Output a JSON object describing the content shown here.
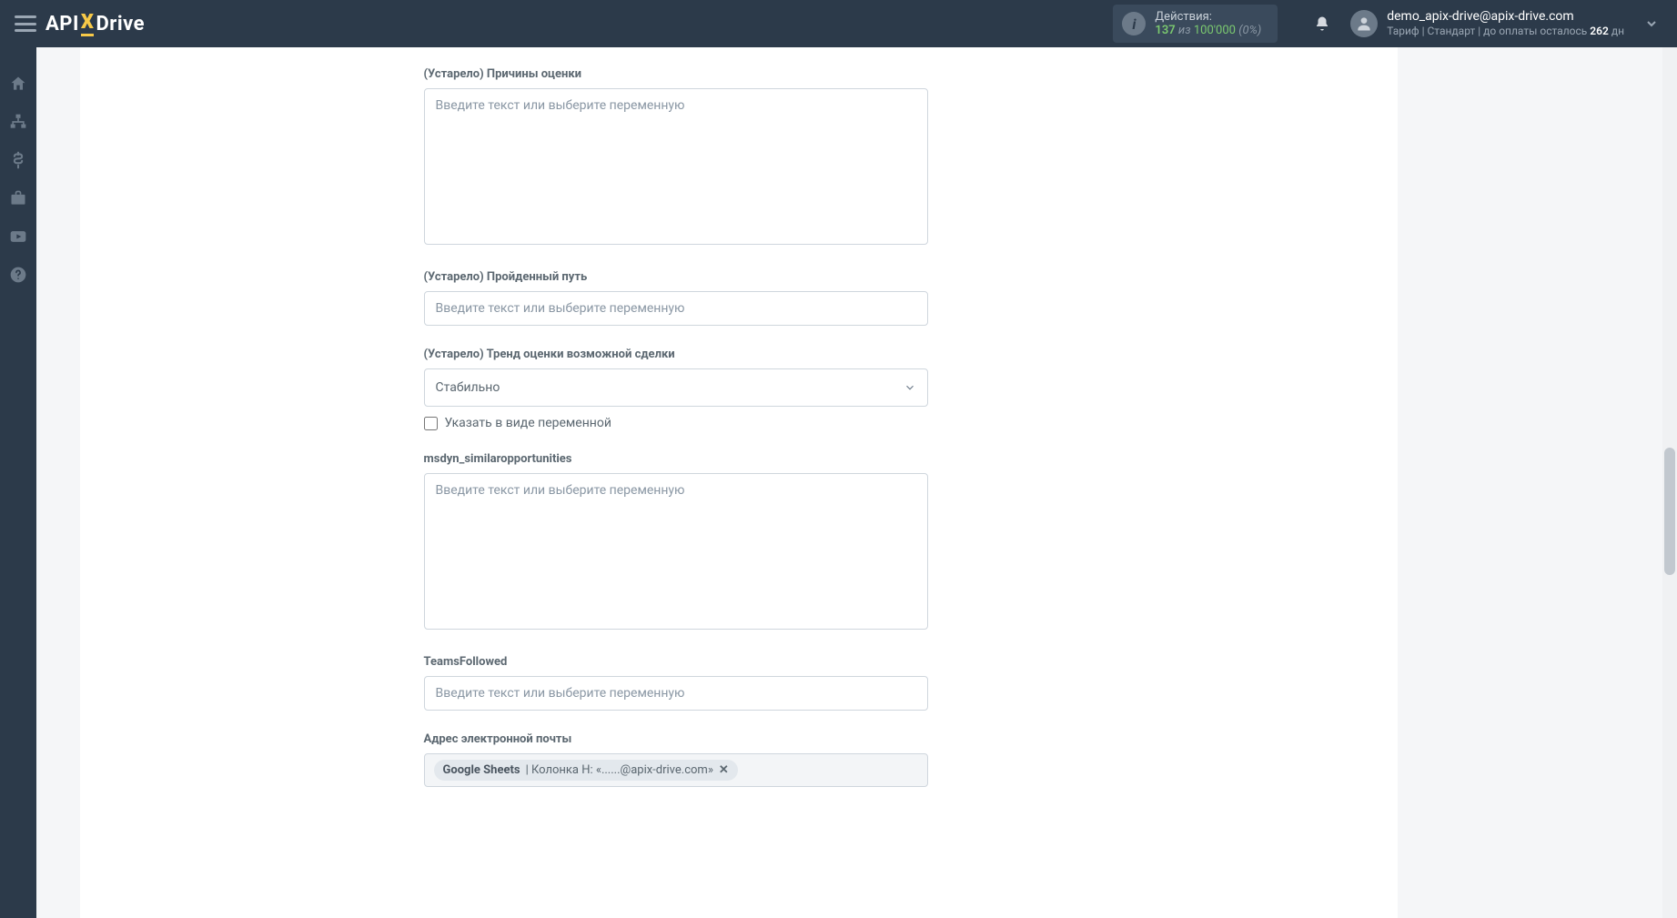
{
  "header": {
    "logo_pre": "API",
    "logo_x": "X",
    "logo_post": "Drive",
    "actions_title": "Действия:",
    "actions_n1": "137",
    "actions_sep": "из",
    "actions_n2": "100'000",
    "actions_pct": "(0%)",
    "user_email": "demo_apix-drive@apix-drive.com",
    "tariff_prefix": "Тариф | Стандарт | до оплаты осталось ",
    "tariff_days": "262",
    "tariff_suffix": " дн"
  },
  "form": {
    "field1": {
      "label": "(Устарело) Причины оценки",
      "placeholder": "Введите текст или выберите переменную"
    },
    "field2": {
      "label": "(Устарело) Пройденный путь",
      "placeholder": "Введите текст или выберите переменную"
    },
    "field3": {
      "label": "(Устарело) Тренд оценки возможной сделки",
      "selected": "Стабильно",
      "checkbox_label": "Указать в виде переменной"
    },
    "field4": {
      "label": "msdyn_similaropportunities",
      "placeholder": "Введите текст или выберите переменную"
    },
    "field5": {
      "label": "TeamsFollowed",
      "placeholder": "Введите текст или выберите переменную"
    },
    "field6": {
      "label": "Адрес электронной почты",
      "tag_bold": "Google Sheets",
      "tag_rest": " | Колонка H: «......@apix-drive.com»"
    }
  }
}
